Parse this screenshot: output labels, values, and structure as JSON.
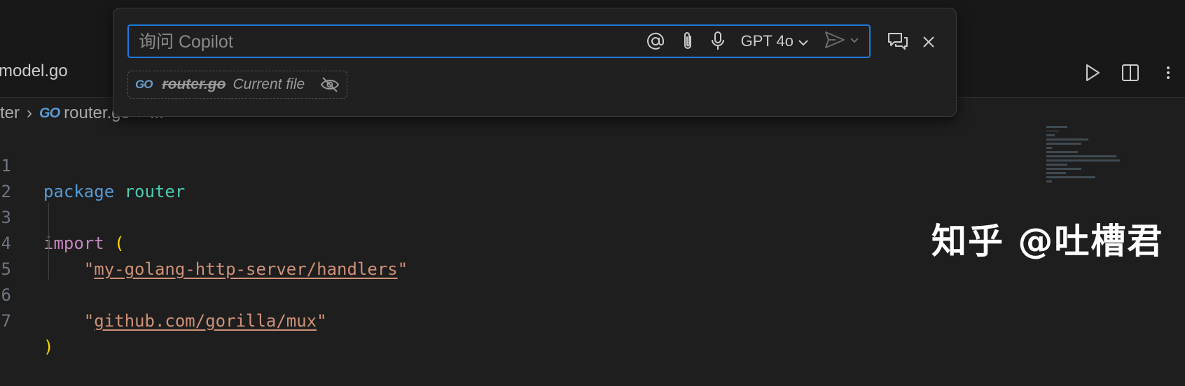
{
  "editor": {
    "tab_label": "model.go",
    "breadcrumb": {
      "folder": "ter",
      "file_badge": "GO",
      "file": "router.go",
      "ellipsis": "..."
    },
    "lines": [
      {
        "num": "1"
      },
      {
        "num": "2"
      },
      {
        "num": "3"
      },
      {
        "num": "4"
      },
      {
        "num": "5"
      },
      {
        "num": "6"
      },
      {
        "num": "7"
      }
    ],
    "code": {
      "package_kw": "package",
      "package_name": "router",
      "import_kw": "import",
      "open_paren": "(",
      "import1": "my-golang-http-server/handlers",
      "import2": "github.com/gorilla/mux",
      "close_paren": ")",
      "quote": "\""
    }
  },
  "chat": {
    "placeholder": "询问 Copilot",
    "value": "",
    "model": "GPT 4o",
    "attachment": {
      "badge": "GO",
      "file": "router.go",
      "description": "Current file"
    },
    "icons": {
      "mention": "at-icon",
      "attach": "paperclip-icon",
      "voice": "microphone-icon",
      "model_chevron": "chevron-down-icon",
      "send": "send-icon",
      "send_chevron": "chevron-down-icon",
      "open_chat": "chat-panel-icon",
      "close": "close-icon",
      "visibility": "eye-closed-icon"
    }
  },
  "editor_actions": {
    "icons": [
      "run-icon",
      "split-editor-icon",
      "more-icon"
    ]
  },
  "watermark": "知乎 @吐槽君",
  "colors": {
    "accent": "#1f7ae0",
    "keyword_blue": "#569cd6",
    "type_teal": "#4ec9b0",
    "keyword_purple": "#c586c0",
    "string": "#ce9178",
    "paren": "#ffd700"
  }
}
